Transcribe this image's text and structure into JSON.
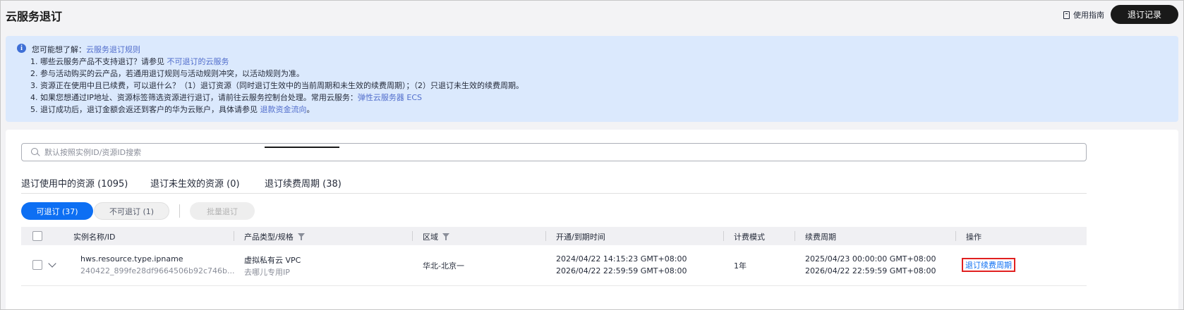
{
  "header": {
    "title": "云服务退订",
    "guide_label": "使用指南",
    "record_button": "退订记录"
  },
  "notice": {
    "intro_prefix": "您可能想了解：",
    "intro_link": "云服务退订规则",
    "items": [
      {
        "text": "1. 哪些云服务产品不支持退订？请参见 ",
        "link": "不可退订的云服务",
        "suffix": ""
      },
      {
        "text": "2. 参与活动购买的云产品，若通用退订规则与活动规则冲突，以活动规则为准。",
        "link": "",
        "suffix": ""
      },
      {
        "text": "3. 资源正在使用中且已续费，可以退什么？（1）退订资源（同时退订生效中的当前周期和未生效的续费周期）；（2）只退订未生效的续费周期。",
        "link": "",
        "suffix": ""
      },
      {
        "text": "4. 如果您想通过IP地址、资源标签筛选资源进行退订，请前往云服务控制台处理。常用云服务：",
        "link": "弹性云服务器 ECS",
        "suffix": ""
      },
      {
        "text": "5. 退订成功后，退订金额会返还到客户的华为云账户，具体请参见 ",
        "link": "退款资金流向",
        "suffix": "。"
      }
    ]
  },
  "search": {
    "placeholder": "默认按照实例ID/资源ID搜索",
    "value": ""
  },
  "tabs": [
    {
      "label": "退订使用中的资源 (1095)",
      "active": false
    },
    {
      "label": "退订未生效的资源 (0)",
      "active": false
    },
    {
      "label": "退订续费周期 (38)",
      "active": true
    }
  ],
  "filters": {
    "refundable": "可退订 (37)",
    "non_refundable": "不可退订 (1)",
    "batch": "批量退订"
  },
  "table": {
    "columns": [
      "实例名称/ID",
      "产品类型/规格",
      "区域",
      "开通/到期时间",
      "计费模式",
      "续费周期",
      "操作"
    ],
    "rows": [
      {
        "name": "hws.resource.type.ipname",
        "id": "240422_899fe28df9664506b92c746b...",
        "product": "虚拟私有云 VPC",
        "spec": "去哪儿专用IP",
        "region": "华北-北京一",
        "open_time": "2024/04/22 14:15:23 GMT+08:00",
        "expire_time": "2026/04/22 22:59:59 GMT+08:00",
        "billing": "1年",
        "renew_start": "2025/04/23 00:00:00 GMT+08:00",
        "renew_end": "2026/04/22 22:59:59 GMT+08:00",
        "action": "退订续费周期"
      }
    ]
  },
  "colors": {
    "primary": "#0d6ff3",
    "link": "#526ecc",
    "notice_bg": "#dbe9fd",
    "highlight": "#e02020",
    "dark_button": "#191919"
  }
}
